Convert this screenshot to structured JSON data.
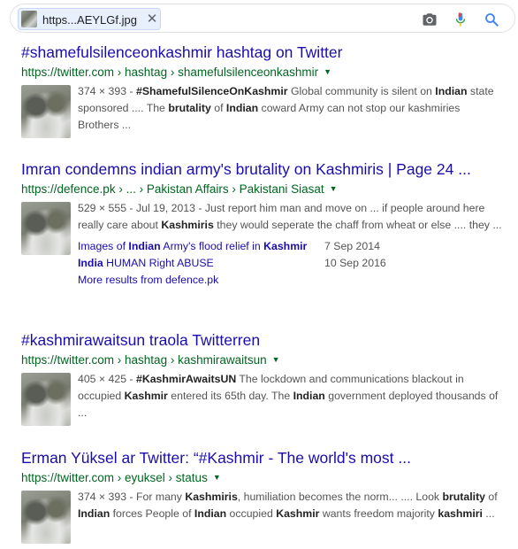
{
  "search": {
    "chip_label": "https...AEYLGf.jpg",
    "close_glyph": "✕",
    "icons": [
      "camera-icon",
      "microphone-icon",
      "search-icon"
    ]
  },
  "results": [
    {
      "title": "#shamefulsilenceonkashmir hashtag on Twitter",
      "url": "https://twitter.com › hashtag › shamefulsilenceonkashmir",
      "snippet": [
        {
          "t": "374 × 393 - "
        },
        {
          "t": "#ShamefulSilenceOnKashmir",
          "b": true
        },
        {
          "t": " Global community is silent on "
        },
        {
          "t": "Indian",
          "b": true
        },
        {
          "t": " state sponsored .... The "
        },
        {
          "t": "brutality",
          "b": true
        },
        {
          "t": " of "
        },
        {
          "t": "Indian",
          "b": true
        },
        {
          "t": " coward Army can not stop our kashmiries Brothers ..."
        }
      ]
    },
    {
      "title": "Imran condemns indian army's brutality on Kashmiris | Page 24 ...",
      "url": "https://defence.pk › ... › Pakistan Affairs › Pakistani Siasat",
      "snippet": [
        {
          "t": "529 × 555 - Jul 19, 2013 - Just report him man and move on ... if people around here really care about "
        },
        {
          "t": "Kashmiris",
          "b": true
        },
        {
          "t": " they would seperate the chaff from wheat or else .... they ..."
        }
      ],
      "sitelinks": [
        {
          "parts": [
            {
              "t": "Images of "
            },
            {
              "t": "Indian",
              "b": true
            },
            {
              "t": " Army's flood relief in "
            },
            {
              "t": "Kashmir",
              "b": true
            }
          ],
          "date": "7 Sep 2014"
        },
        {
          "parts": [
            {
              "t": "India",
              "b": true
            },
            {
              "t": " HUMAN Right ABUSE"
            }
          ],
          "date": "10 Sep 2016"
        },
        {
          "parts": [
            {
              "t": "More results from defence.pk"
            }
          ],
          "date": ""
        }
      ]
    },
    {
      "title": "#kashmirawaitsun traola Twitterren",
      "url": "https://twitter.com › hashtag › kashmirawaitsun",
      "snippet": [
        {
          "t": "405 × 425 - "
        },
        {
          "t": "#KashmirAwaitsUN",
          "b": true
        },
        {
          "t": " The lockdown and communications blackout in occupied "
        },
        {
          "t": "Kashmir",
          "b": true
        },
        {
          "t": " entered its 65th day. The "
        },
        {
          "t": "Indian",
          "b": true
        },
        {
          "t": " government deployed thousands of ..."
        }
      ]
    },
    {
      "title": "Erman Yüksel ar Twitter: “#Kashmir - The world's most ...",
      "url": "https://twitter.com › eyuksel › status",
      "snippet": [
        {
          "t": "374 × 393 - For many "
        },
        {
          "t": "Kashmiris",
          "b": true
        },
        {
          "t": ", humiliation becomes the norm... .... Look "
        },
        {
          "t": "brutality",
          "b": true
        },
        {
          "t": " of "
        },
        {
          "t": "Indian",
          "b": true
        },
        {
          "t": " forces People of "
        },
        {
          "t": "Indian",
          "b": true
        },
        {
          "t": " occupied "
        },
        {
          "t": "Kashmir",
          "b": true
        },
        {
          "t": " wants freedom majority "
        },
        {
          "t": "kashmiri",
          "b": true
        },
        {
          "t": " ..."
        }
      ]
    }
  ],
  "colors": {
    "title": "#1a0dab",
    "url": "#006621",
    "snippet": "#545454",
    "mic_blue": "#4285f4",
    "mic_red": "#ea4335",
    "search_blue": "#4285f4"
  }
}
